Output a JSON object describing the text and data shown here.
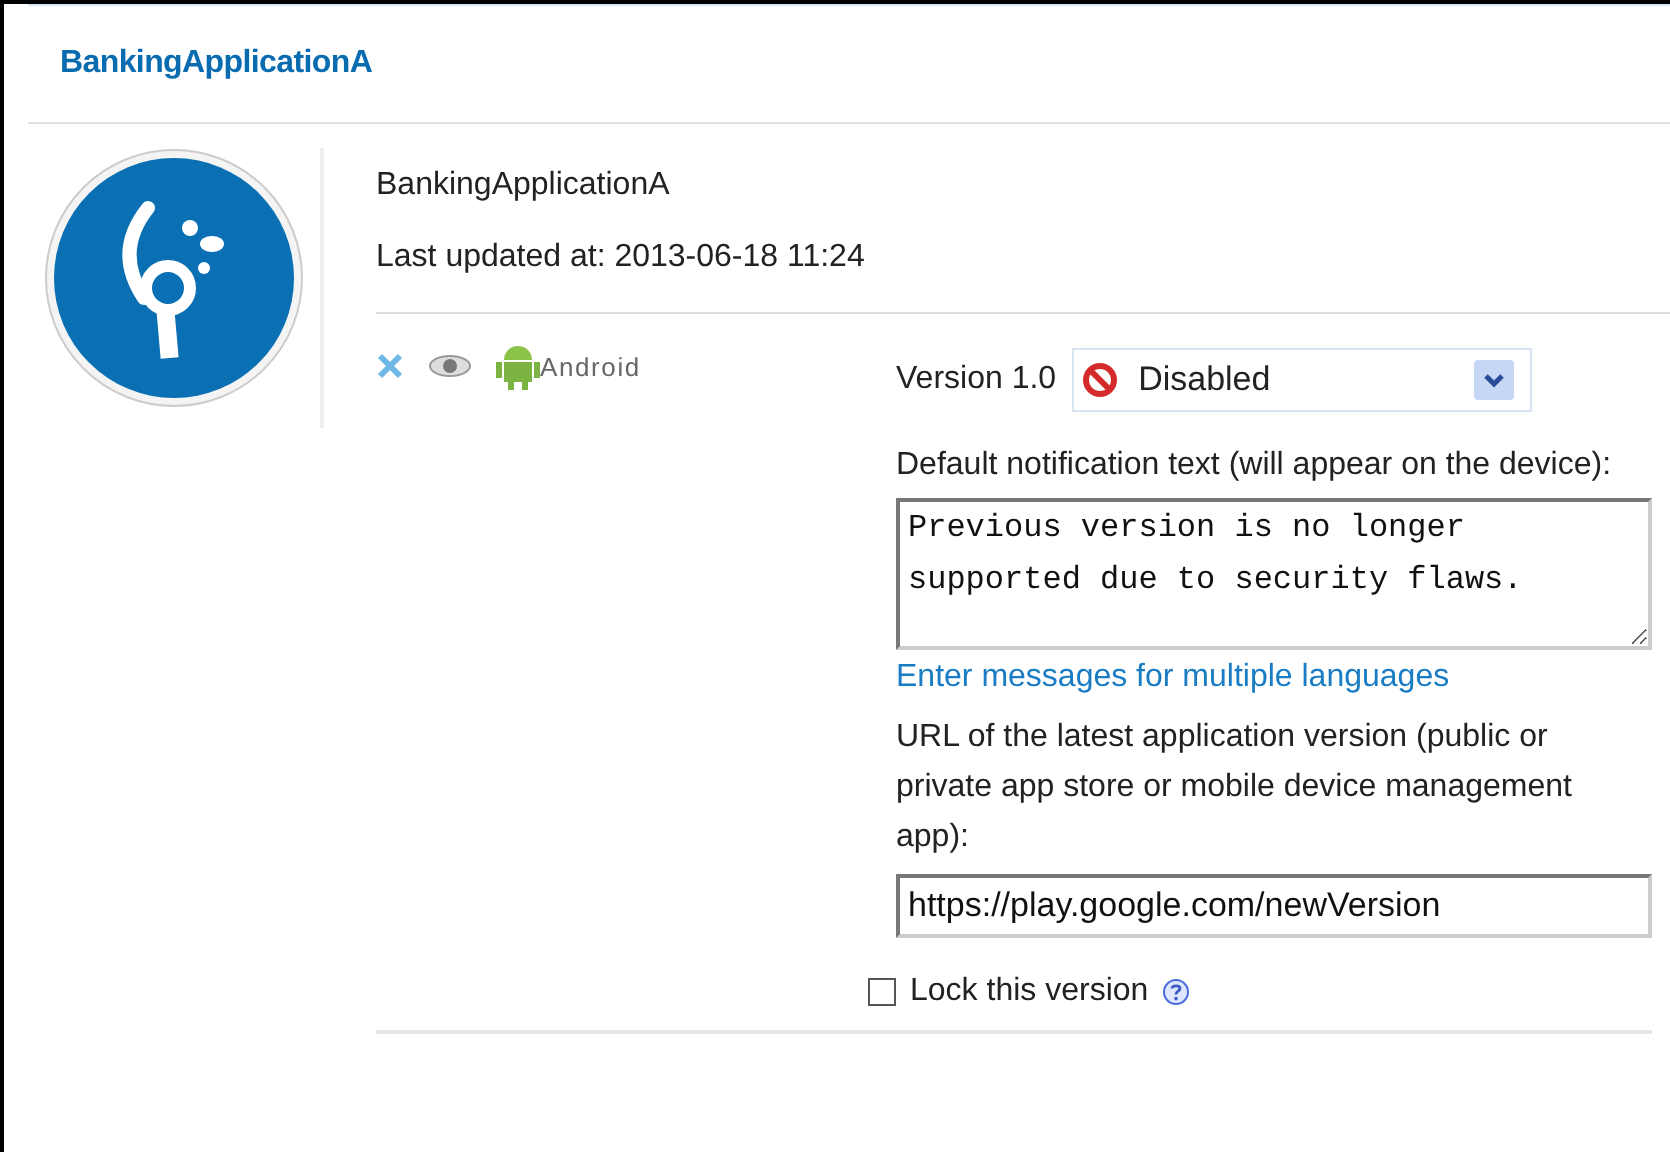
{
  "header": {
    "title": "BankingApplicationA"
  },
  "app": {
    "name": "BankingApplicationA",
    "last_updated": "Last updated at: 2013-06-18 11:24"
  },
  "platform": {
    "label": "Android"
  },
  "version": {
    "label": "Version 1.0",
    "status": "Disabled",
    "kind": "disabled"
  },
  "notification": {
    "label": "Default notification text (will appear on the device):",
    "value": "Previous version is no longer supported due to security flaws.",
    "link": "Enter messages for multiple languages"
  },
  "url": {
    "label": "URL of the latest application version (public or private app store or mobile device management app):",
    "value": "https://play.google.com/newVersion"
  },
  "lock": {
    "label": "Lock this version",
    "checked": false
  }
}
